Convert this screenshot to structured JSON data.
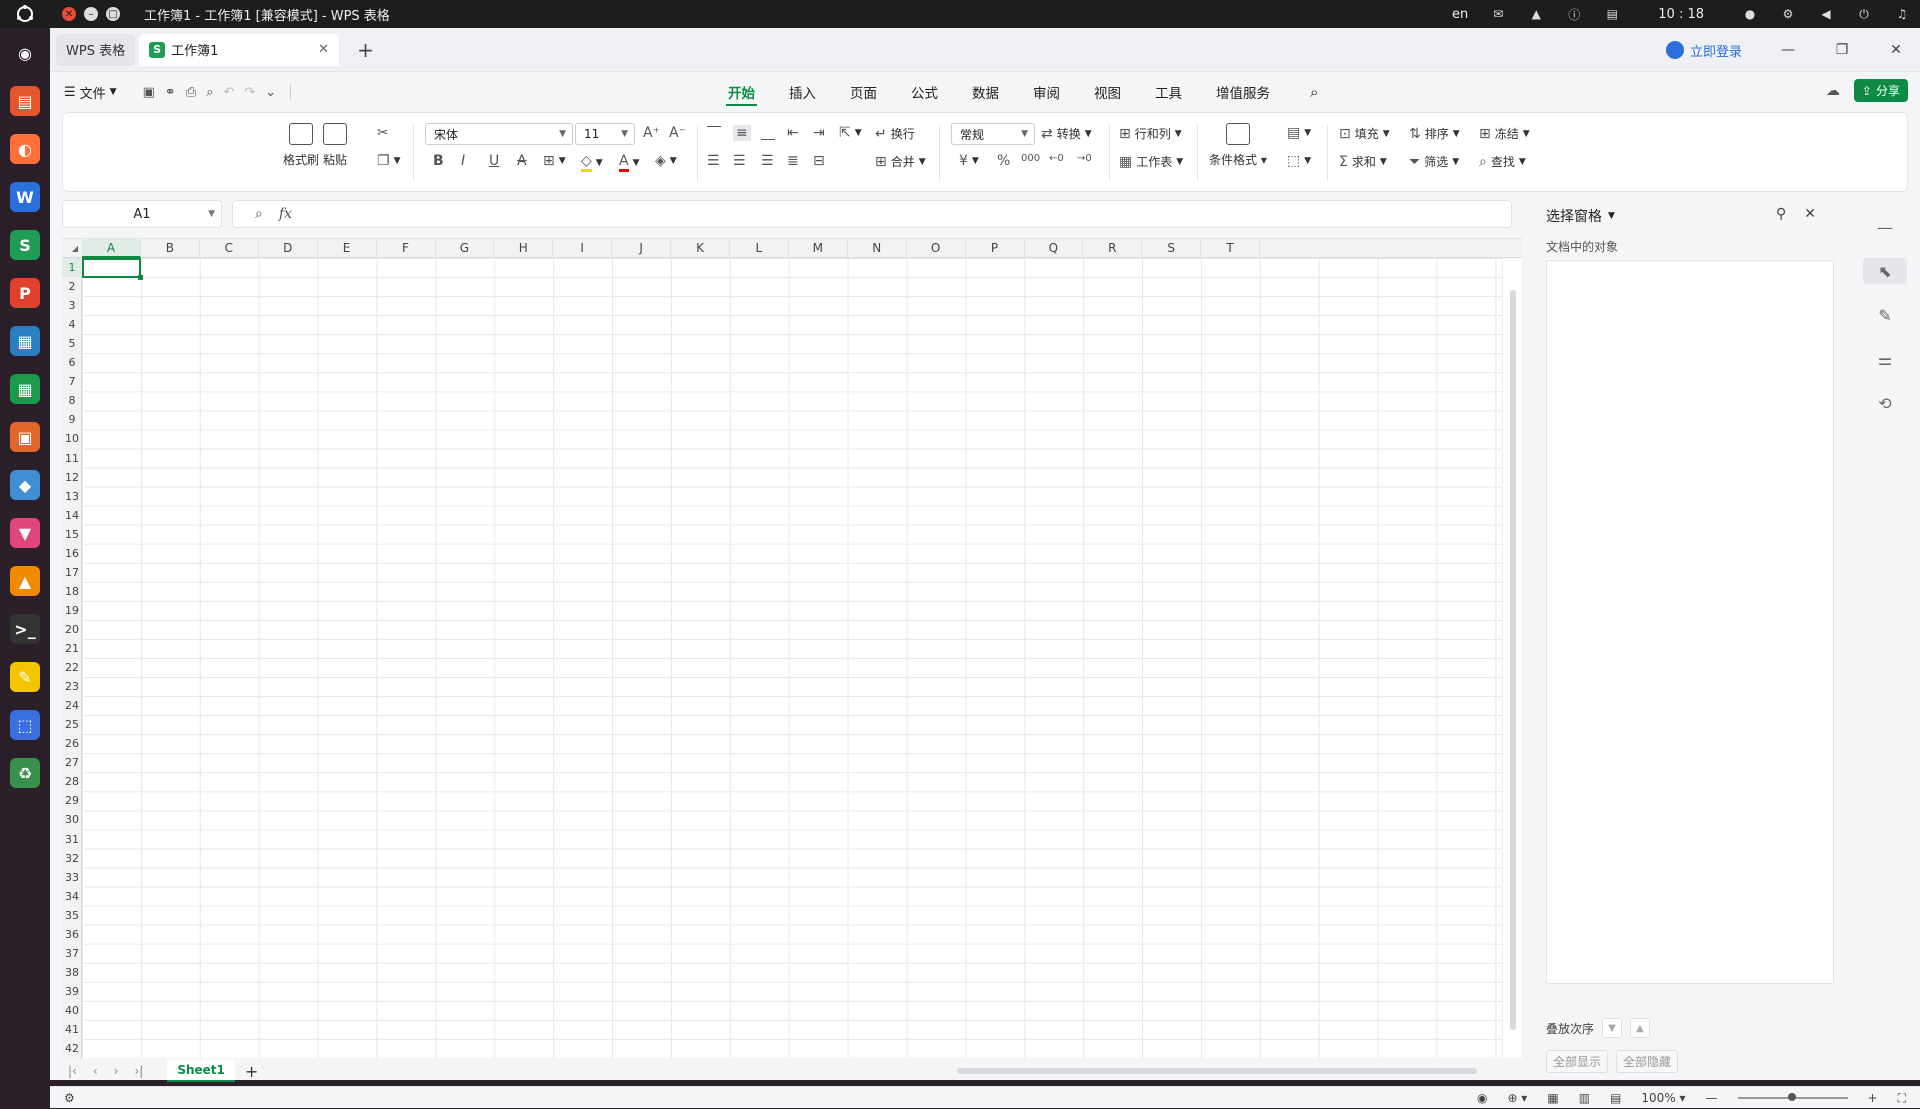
{
  "system": {
    "window_title": "工作簿1 - 工作簿1 [兼容模式] - WPS 表格",
    "lang": "en",
    "clock": "10 : 18"
  },
  "dock": {
    "apps": [
      {
        "name": "ubuntu-icon",
        "glyph": "◉",
        "bg": "#2b1f2a"
      },
      {
        "name": "files-icon",
        "glyph": "▤",
        "bg": "#e4572e"
      },
      {
        "name": "firefox-icon",
        "glyph": "◐",
        "bg": "#ff7139"
      },
      {
        "name": "wps-writer-icon",
        "glyph": "W",
        "bg": "#2a6fdb"
      },
      {
        "name": "wps-sheets-icon",
        "glyph": "S",
        "bg": "#1f9d55"
      },
      {
        "name": "wps-presentation-icon",
        "glyph": "P",
        "bg": "#e0412f"
      },
      {
        "name": "doc-viewer-icon",
        "glyph": "▦",
        "bg": "#2a7fc1"
      },
      {
        "name": "spreadsheet-app-icon",
        "glyph": "▦",
        "bg": "#1a9b4b"
      },
      {
        "name": "slides-app-icon",
        "glyph": "▣",
        "bg": "#e2652c"
      },
      {
        "name": "store-icon",
        "glyph": "◆",
        "bg": "#3f8fd2"
      },
      {
        "name": "pdf-icon",
        "glyph": "▼",
        "bg": "#e0457b"
      },
      {
        "name": "vlc-icon",
        "glyph": "▲",
        "bg": "#f08a00"
      },
      {
        "name": "terminal-icon",
        "glyph": ">_",
        "bg": "#333"
      },
      {
        "name": "text-editor-icon",
        "glyph": "✎",
        "bg": "#f5c400"
      },
      {
        "name": "screenshot-icon",
        "glyph": "⬚",
        "bg": "#3b6fe0"
      },
      {
        "name": "trash-icon",
        "glyph": "♻",
        "bg": "#3a8f4a"
      }
    ]
  },
  "tabs": {
    "home_label": "WPS 表格",
    "doc_label": "工作簿1",
    "login_label": "立即登录"
  },
  "menu": {
    "file_label": "文件",
    "tabs": [
      "开始",
      "插入",
      "页面",
      "公式",
      "数据",
      "审阅",
      "视图",
      "工具",
      "增值服务"
    ],
    "active_tab": "开始",
    "share_label": "分享"
  },
  "ribbon": {
    "format_painter": "格式刷",
    "paste": "粘贴",
    "font_name": "宋体",
    "font_size": "11",
    "wrap": "换行",
    "merge": "合并",
    "number_format": "常规",
    "convert": "转换",
    "rows_cols": "行和列",
    "worksheet": "工作表",
    "cond_format": "条件格式",
    "fill": "填充",
    "sort": "排序",
    "freeze": "冻结",
    "sum": "求和",
    "filter": "筛选",
    "find": "查找",
    "currency_symbol": "¥",
    "percent_symbol": "%",
    "thousands_symbol": "000"
  },
  "formula_bar": {
    "cell_ref": "A1",
    "fx": "fx",
    "value": ""
  },
  "grid": {
    "columns": [
      "A",
      "B",
      "C",
      "D",
      "E",
      "F",
      "G",
      "H",
      "I",
      "J",
      "K",
      "L",
      "M",
      "N",
      "O",
      "P",
      "Q",
      "R",
      "S",
      "T"
    ],
    "rows": [
      "1",
      "2",
      "3",
      "4",
      "5",
      "6",
      "7",
      "8",
      "9",
      "10",
      "11",
      "12",
      "13",
      "14",
      "15",
      "16",
      "17",
      "18",
      "19",
      "20",
      "21",
      "22",
      "23",
      "24",
      "25",
      "26",
      "27",
      "28",
      "29",
      "30",
      "31",
      "32",
      "33",
      "34",
      "35",
      "36",
      "37",
      "38",
      "39",
      "40",
      "41",
      "42"
    ],
    "active_col": "A",
    "active_row": "1"
  },
  "sheets": {
    "names": [
      "Sheet1"
    ]
  },
  "pane": {
    "title": "选择窗格",
    "objects_label": "文档中的对象",
    "order_label": "叠放次序",
    "show_all": "全部显示",
    "hide_all": "全部隐藏"
  },
  "status": {
    "zoom": "100%"
  },
  "colors": {
    "accent": "#0e8a45",
    "link": "#2a6fdb"
  }
}
